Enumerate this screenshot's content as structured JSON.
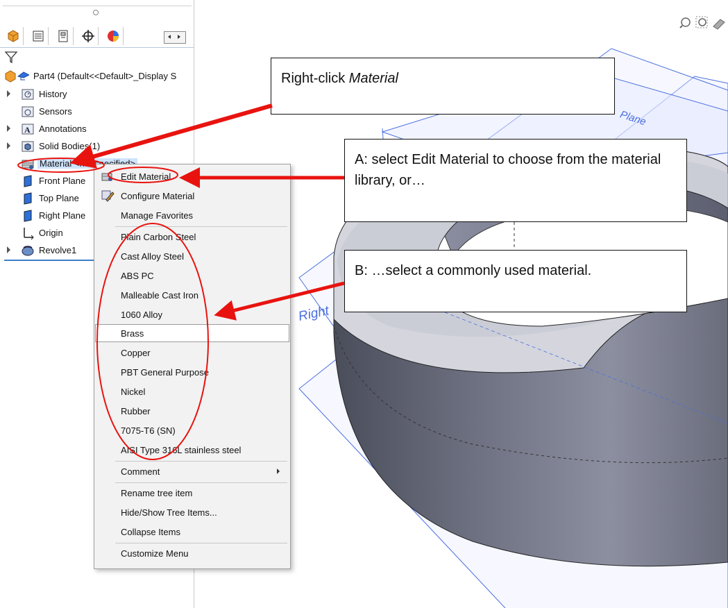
{
  "tree": {
    "root_label": "Part4  (Default<<Default>_Display S",
    "items": [
      {
        "label": "History",
        "icon": "history-folder-icon",
        "expandable": true
      },
      {
        "label": "Sensors",
        "icon": "sensors-icon",
        "expandable": false
      },
      {
        "label": "Annotations",
        "icon": "annotations-icon",
        "expandable": true
      },
      {
        "label": "Solid Bodies(1)",
        "icon": "solid-bodies-icon",
        "expandable": true
      },
      {
        "label": "Material <not specified>",
        "icon": "material-icon",
        "expandable": false,
        "selected": true
      },
      {
        "label": "Front Plane",
        "icon": "plane-icon",
        "expandable": false
      },
      {
        "label": "Top Plane",
        "icon": "plane-icon",
        "expandable": false
      },
      {
        "label": "Right Plane",
        "icon": "plane-icon",
        "expandable": false
      },
      {
        "label": "Origin",
        "icon": "origin-icon",
        "expandable": false
      },
      {
        "label": "Revolve1",
        "icon": "revolve-icon",
        "expandable": true
      }
    ]
  },
  "menu": {
    "edit_material": "Edit Material",
    "configure_material": "Configure Material",
    "manage_favorites": "Manage Favorites",
    "materials": [
      "Plain Carbon Steel",
      "Cast Alloy Steel",
      "ABS PC",
      "Malleable Cast Iron",
      "1060 Alloy",
      "Brass",
      "Copper",
      "PBT General Purpose",
      "Nickel",
      "Rubber",
      "7075-T6 (SN)",
      "AISI Type 316L stainless steel"
    ],
    "highlighted": "Brass",
    "comment": "Comment",
    "rename": "Rename tree item",
    "hide_show": "Hide/Show Tree Items...",
    "collapse": "Collapse Items",
    "customize": "Customize Menu"
  },
  "callouts": {
    "right_click_prefix": "Right-click ",
    "right_click_em": "Material",
    "a": "A: select Edit Material to choose from the material library, or…",
    "b": "B: …select a commonly used material."
  },
  "graphics": {
    "plane_labels": [
      "Plane",
      "Right"
    ]
  },
  "colors": {
    "annotation_red": "#e8130f",
    "plane_blue": "#4a6fe0",
    "selection": "#cfe3fb"
  }
}
